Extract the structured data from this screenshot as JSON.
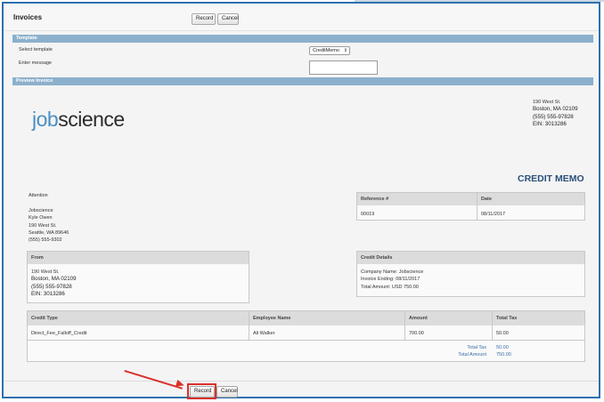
{
  "window": {
    "title": "Invoices"
  },
  "toolbar": {
    "record_label": "Record",
    "cancel_label": "Cancel"
  },
  "template_section": {
    "header": "Template",
    "select_label": "Select template",
    "select_value": "CreditMemo",
    "message_label": "Enter message",
    "message_value": ""
  },
  "preview_section": {
    "header": "Preview Invoice"
  },
  "company": {
    "logo_part1": "job",
    "logo_part2": "science",
    "addr1": "190 West St.",
    "addr2": "Boston, MA 02109",
    "phone": "(555) 555-97828",
    "ein": "EIN: 3013286"
  },
  "doc_title": "CREDIT MEMO",
  "attention": {
    "label": "Attention",
    "lines": [
      "Jobscience",
      "Kyle Owen",
      "190 West St.",
      "Seattle, WA 89646",
      "(555) 555-9302"
    ]
  },
  "reference": {
    "ref_header": "Reference #",
    "date_header": "Date",
    "ref_value": "00019",
    "date_value": "08/11/2017"
  },
  "from_box": {
    "header": "From",
    "addr1": "190 West St.",
    "addr2": "Boston, MA 02109",
    "phone": "(555) 555-97828",
    "ein": "EIN: 3013286"
  },
  "credit_details": {
    "header": "Credit Details",
    "company_name": "Company Name: Jobscience",
    "invoice_ending": "Invoice Ending:  08/11/2017",
    "total_amount": "Total Amount:  USD 750.00"
  },
  "line_table": {
    "headers": [
      "Credit Type",
      "Employee Name",
      "Amount",
      "Total Tax"
    ],
    "rows": [
      [
        "Direct_Fee_Falloff_Credit",
        "Ali Walker",
        "700.00",
        "50.00"
      ]
    ],
    "total_tax_label": "Total Tax",
    "total_tax_value": "50.00",
    "total_amount_label": "Total Amount",
    "total_amount_value": "750.00"
  },
  "footer": {
    "record_label": "Record",
    "cancel_label": "Cancel"
  },
  "colors": {
    "section_header": "#8cb0cc",
    "accent_red": "#d9302a",
    "frame_blue": "#2f6fae",
    "link_blue": "#3a6ea8"
  }
}
